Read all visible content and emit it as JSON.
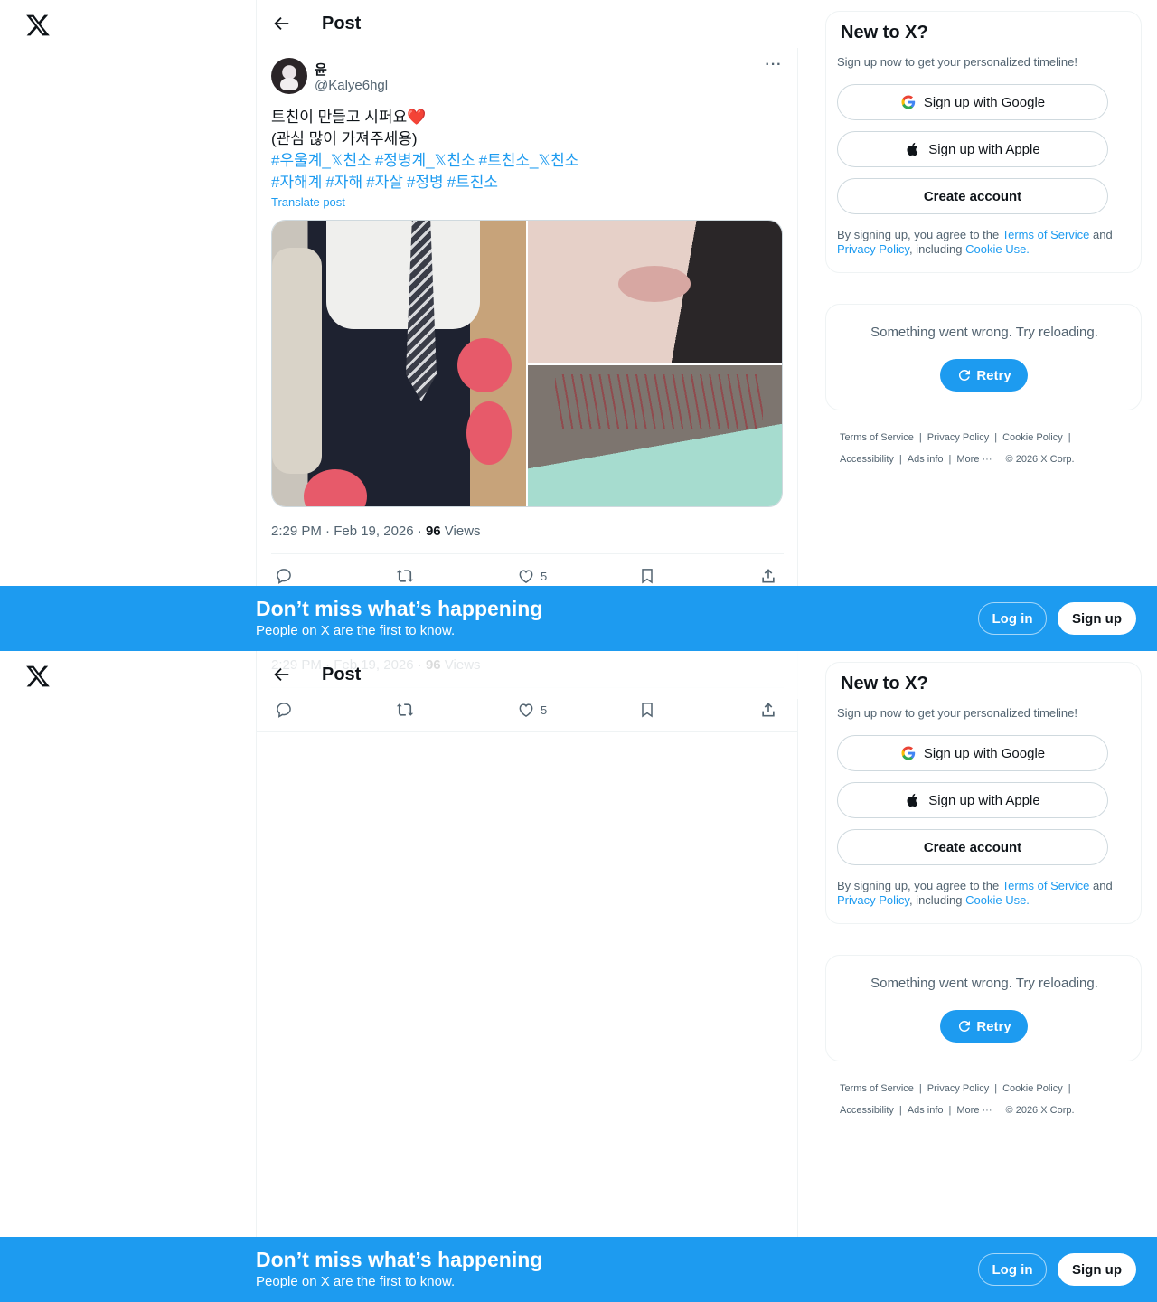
{
  "page": {
    "title": "Post"
  },
  "post": {
    "author_name": "윤",
    "author_handle": "@Kalye6hgl",
    "line1": "트친이 만들고 시퍼요❤️",
    "line2": "(관심 많이 가져주세용)",
    "hashtags_row1": [
      "#우울계_𝕏친소",
      "#정병계_𝕏친소",
      "#트친소_𝕏친소"
    ],
    "hashtags_row2": [
      "#자해계",
      "#자해",
      "#자살",
      "#정병",
      "#트친소"
    ],
    "translate": "Translate post",
    "time": "2:29 PM · Feb 19, 2026 · ",
    "views_count": "96",
    "views_label": " Views",
    "likes": "5"
  },
  "sidebar": {
    "heading": "New to X?",
    "sub": "Sign up now to get your personalized timeline!",
    "google": "Sign up with Google",
    "apple": "Sign up with Apple",
    "create": "Create account",
    "terms_prefix": "By signing up, you agree to the ",
    "terms_link": "Terms of Service",
    "terms_and": " and ",
    "privacy_link": "Privacy Policy",
    "including": ", including ",
    "cookie_link": "Cookie Use.",
    "error_msg": "Something went wrong. Try reloading.",
    "retry": "Retry",
    "footer": [
      "Terms of Service",
      "Privacy Policy",
      "Cookie Policy",
      "Accessibility",
      "Ads info",
      "More ···",
      "© 2026 X Corp."
    ]
  },
  "banner": {
    "title": "Don’t miss what’s happening",
    "subtitle": "People on X are the first to know.",
    "login": "Log in",
    "signup": "Sign up"
  },
  "colors": {
    "accent": "#1d9bf0",
    "text": "#0f1419",
    "muted": "#536471"
  }
}
